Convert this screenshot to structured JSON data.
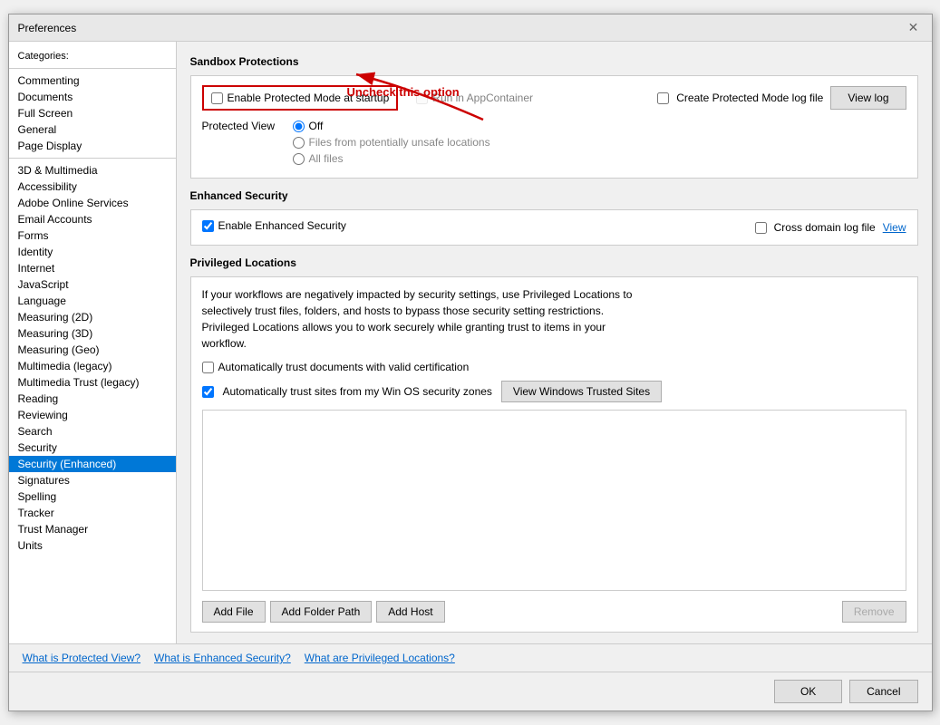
{
  "dialog": {
    "title": "Preferences"
  },
  "sidebar": {
    "header": "Categories:",
    "items": [
      {
        "label": "Commenting",
        "selected": false
      },
      {
        "label": "Documents",
        "selected": false
      },
      {
        "label": "Full Screen",
        "selected": false
      },
      {
        "label": "General",
        "selected": false
      },
      {
        "label": "Page Display",
        "selected": false
      },
      {
        "label": "3D & Multimedia",
        "selected": false
      },
      {
        "label": "Accessibility",
        "selected": false
      },
      {
        "label": "Adobe Online Services",
        "selected": false
      },
      {
        "label": "Email Accounts",
        "selected": false
      },
      {
        "label": "Forms",
        "selected": false
      },
      {
        "label": "Identity",
        "selected": false
      },
      {
        "label": "Internet",
        "selected": false
      },
      {
        "label": "JavaScript",
        "selected": false
      },
      {
        "label": "Language",
        "selected": false
      },
      {
        "label": "Measuring (2D)",
        "selected": false
      },
      {
        "label": "Measuring (3D)",
        "selected": false
      },
      {
        "label": "Measuring (Geo)",
        "selected": false
      },
      {
        "label": "Multimedia (legacy)",
        "selected": false
      },
      {
        "label": "Multimedia Trust (legacy)",
        "selected": false
      },
      {
        "label": "Reading",
        "selected": false
      },
      {
        "label": "Reviewing",
        "selected": false
      },
      {
        "label": "Search",
        "selected": false
      },
      {
        "label": "Security",
        "selected": false
      },
      {
        "label": "Security (Enhanced)",
        "selected": true
      },
      {
        "label": "Signatures",
        "selected": false
      },
      {
        "label": "Spelling",
        "selected": false
      },
      {
        "label": "Tracker",
        "selected": false
      },
      {
        "label": "Trust Manager",
        "selected": false
      },
      {
        "label": "Units",
        "selected": false
      }
    ]
  },
  "main": {
    "sandbox_section_title": "Sandbox Protections",
    "enable_protected_mode_label": "Enable Protected Mode at startup",
    "enable_protected_mode_checked": false,
    "run_in_appcontainer_label": "Run in AppContainer",
    "run_in_appcontainer_checked": false,
    "create_log_label": "Create Protected Mode log file",
    "create_log_checked": false,
    "view_log_label": "View log",
    "protected_view_label": "Protected View",
    "protected_view_off_label": "Off",
    "protected_view_off_selected": true,
    "protected_view_unsafe_label": "Files from potentially unsafe locations",
    "protected_view_unsafe_selected": false,
    "protected_view_all_label": "All files",
    "protected_view_all_selected": false,
    "annotation_text": "Uncheck this option",
    "enhanced_section_title": "Enhanced Security",
    "enable_enhanced_label": "Enable Enhanced Security",
    "enable_enhanced_checked": true,
    "cross_domain_label": "Cross domain log file",
    "cross_domain_checked": false,
    "view_enhanced_label": "View",
    "privileged_section_title": "Privileged Locations",
    "privileged_desc": "If your workflows are negatively impacted by security settings, use Privileged Locations to\nselectively trust files, folders, and hosts to bypass those security setting restrictions.\nPrivileged Locations allows you to work securely while granting trust to items in your\nworkflow.",
    "auto_trust_certs_label": "Automatically trust documents with valid certification",
    "auto_trust_certs_checked": false,
    "auto_trust_sites_label": "Automatically trust sites from my Win OS security zones",
    "auto_trust_sites_checked": true,
    "view_trusted_sites_label": "View Windows Trusted Sites",
    "add_file_label": "Add File",
    "add_folder_label": "Add Folder Path",
    "add_host_label": "Add Host",
    "remove_label": "Remove",
    "footer_link1": "What is Protected View?",
    "footer_link2": "What is Enhanced Security?",
    "footer_link3": "What are Privileged Locations?",
    "ok_label": "OK",
    "cancel_label": "Cancel"
  }
}
